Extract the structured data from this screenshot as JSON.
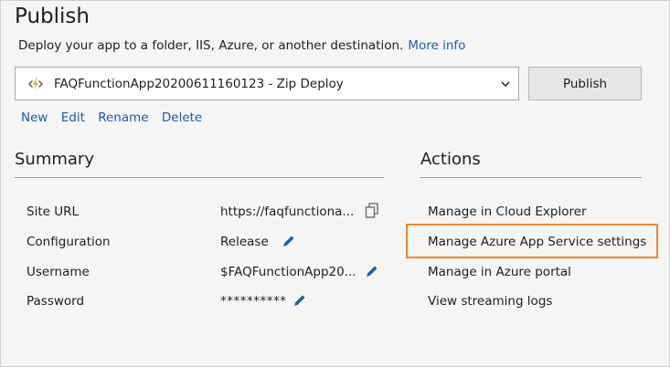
{
  "header": {
    "title": "Publish",
    "description": "Deploy your app to a folder, IIS, Azure, or another destination.",
    "more_info_link": "More info"
  },
  "profile": {
    "selected": "FAQFunctionApp20200611160123 - Zip Deploy",
    "icon": "azure-function-icon",
    "publish_button": "Publish",
    "actions": [
      "New",
      "Edit",
      "Rename",
      "Delete"
    ]
  },
  "summary": {
    "heading": "Summary",
    "rows": [
      {
        "label": "Site URL",
        "value": "https://faqfunctiona...",
        "action_icon": "copy-icon"
      },
      {
        "label": "Configuration",
        "value": "Release",
        "action_icon": "edit-pencil-icon"
      },
      {
        "label": "Username",
        "value": "$FAQFunctionApp20...",
        "action_icon": "edit-pencil-icon"
      },
      {
        "label": "Password",
        "value": "**********",
        "action_icon": "edit-pencil-icon"
      }
    ]
  },
  "actions": {
    "heading": "Actions",
    "links": [
      "Manage in Cloud Explorer",
      "Manage Azure App Service settings",
      "Manage in Azure portal",
      "View streaming logs"
    ]
  },
  "colors": {
    "link": "#1a5ea8",
    "highlight": "#f0882a",
    "azure_function_icon": "#f5a623",
    "edit_icon": "#1a5ea8"
  }
}
